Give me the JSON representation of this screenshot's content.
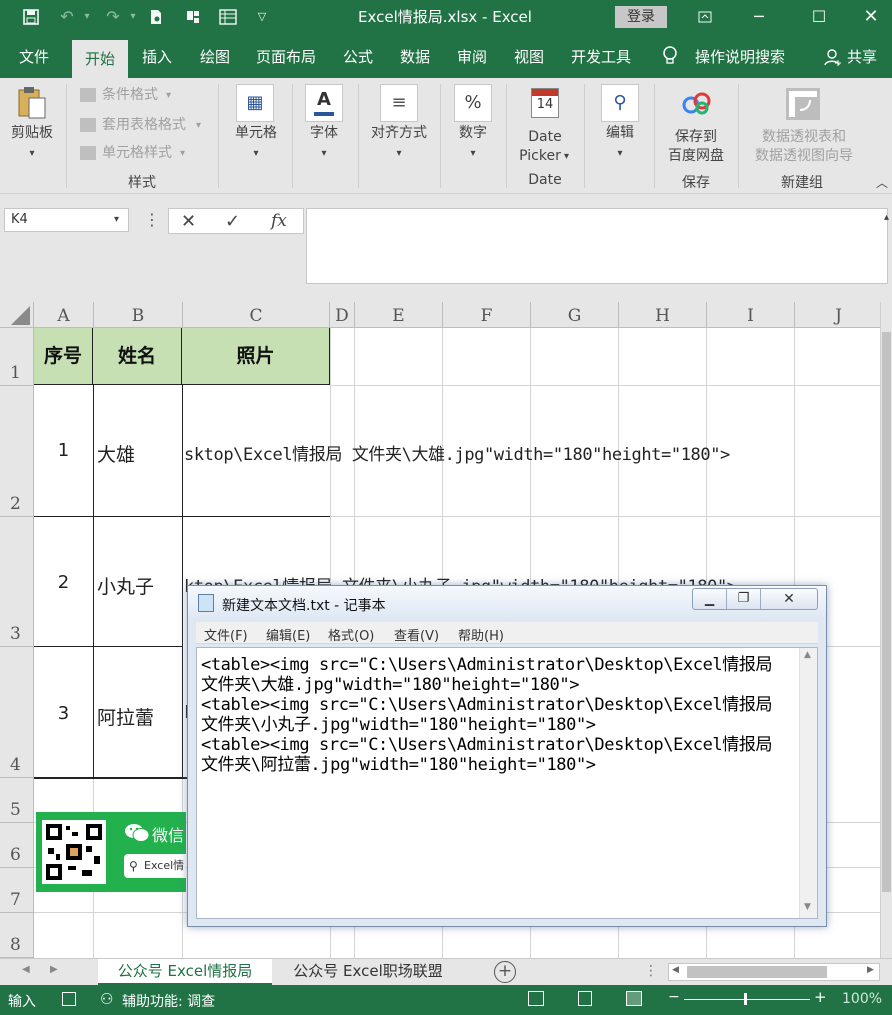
{
  "titlebar": {
    "title": "Excel情报局.xlsx  -  Excel",
    "login": "登录"
  },
  "tabs": [
    "文件",
    "开始",
    "插入",
    "绘图",
    "页面布局",
    "公式",
    "数据",
    "审阅",
    "视图",
    "开发工具",
    "操作说明搜索",
    "共享"
  ],
  "ribbon": {
    "clipboard": "剪贴板",
    "cond_format": "条件格式",
    "table_format": "套用表格格式",
    "cell_style": "单元格样式",
    "style_group": "样式",
    "cells": "单元格",
    "font": "字体",
    "align": "对齐方式",
    "number": "数字",
    "datepicker1": "Date",
    "datepicker2": "Picker",
    "calendar_day": "14",
    "date_group": "Date",
    "edit": "编辑",
    "save1": "保存到",
    "save2": "百度网盘",
    "save_group": "保存",
    "pivot1": "数据透视表和",
    "pivot2": "数据透视图向导",
    "new_group": "新建组"
  },
  "formula": {
    "namebox": "K4",
    "fx": "fx"
  },
  "columns": [
    "A",
    "B",
    "C",
    "D",
    "E",
    "F",
    "G",
    "H",
    "I",
    "J"
  ],
  "rows": [
    "1",
    "2",
    "3",
    "4",
    "5",
    "6",
    "7",
    "8"
  ],
  "table": {
    "headers": [
      "序号",
      "姓名",
      "照片"
    ],
    "rows": [
      {
        "no": "1",
        "name": "大雄",
        "html": "sktop\\Excel情报局 文件夹\\大雄.jpg\"width=\"180\"height=\"180\">"
      },
      {
        "no": "2",
        "name": "小丸子",
        "html": "ktop\\Excel情报局 文件夹\\小丸子.jpg\"width=\"180\"height=\"180\">"
      },
      {
        "no": "3",
        "name": "阿拉蕾",
        "html": "k"
      }
    ]
  },
  "notepad": {
    "title": "新建文本文档.txt - 记事本",
    "menu": [
      "文件(F)",
      "编辑(E)",
      "格式(O)",
      "查看(V)",
      "帮助(H)"
    ],
    "lines": [
      "<table><img src=\"C:\\Users\\Administrator\\Desktop\\Excel情报局",
      "文件夹\\大雄.jpg\"width=\"180\"height=\"180\">",
      "<table><img src=\"C:\\Users\\Administrator\\Desktop\\Excel情报局",
      "文件夹\\小丸子.jpg\"width=\"180\"height=\"180\">",
      "<table><img src=\"C:\\Users\\Administrator\\Desktop\\Excel情报局",
      "文件夹\\阿拉蕾.jpg\"width=\"180\"height=\"180\">"
    ]
  },
  "wechat": {
    "label": "微信",
    "search": "Excel情"
  },
  "sheettabs": [
    "公众号 Excel情报局",
    "公众号 Excel职场联盟"
  ],
  "status": {
    "mode": "输入",
    "accessibility": "辅助功能: 调查",
    "zoom": "100%"
  },
  "colors": {
    "accent": "#217346",
    "header_fill": "#c6e0b4",
    "wechat": "#22b14c"
  }
}
